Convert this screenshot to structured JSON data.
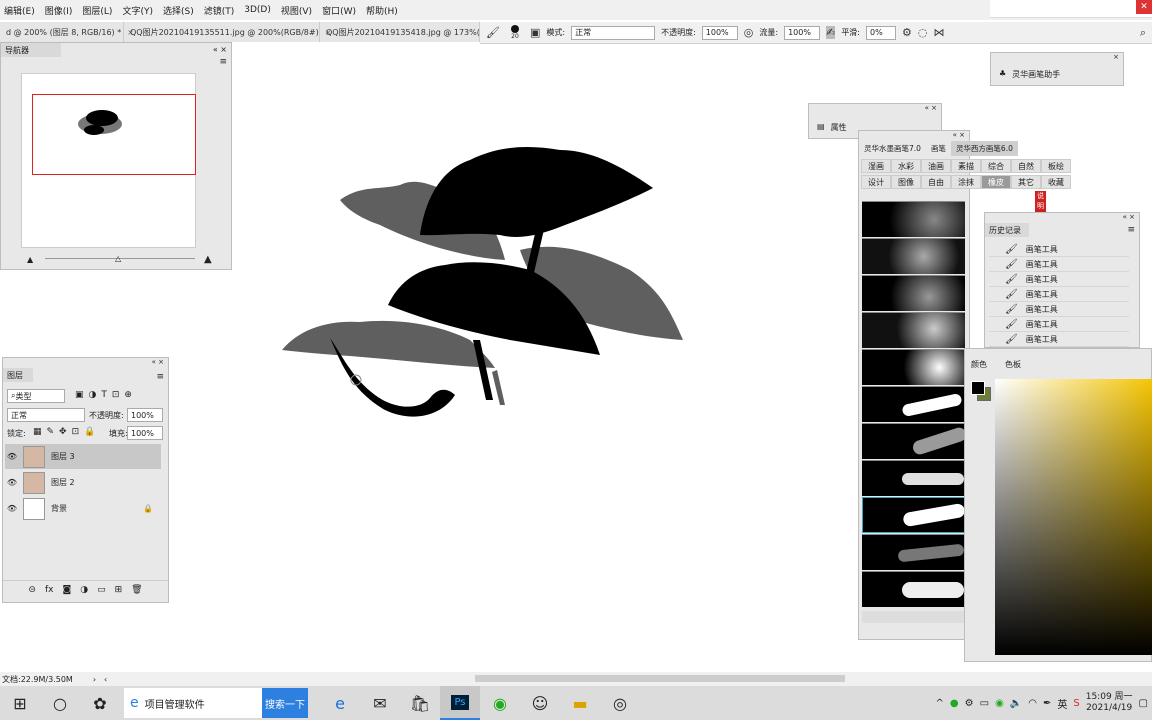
{
  "menu": [
    "编辑(E)",
    "图像(I)",
    "图层(L)",
    "文字(Y)",
    "选择(S)",
    "滤镜(T)",
    "3D(D)",
    "视图(V)",
    "窗口(W)",
    "帮助(H)"
  ],
  "doc_tabs": [
    {
      "label": "d @ 200% (图层 8, RGB/16) *",
      "close": "×"
    },
    {
      "label": "QQ图片20210419135511.jpg @ 200%(RGB/8#)",
      "close": "×"
    },
    {
      "label": "QQ图片20210419135418.jpg @ 173%(RG",
      "close": ""
    }
  ],
  "options": {
    "brush_size": "20",
    "mode_label": "模式:",
    "mode_value": "正常",
    "opacity_label": "不透明度:",
    "opacity_value": "100%",
    "flow_label": "流量:",
    "flow_value": "100%",
    "smooth_label": "平滑:",
    "smooth_value": "0%"
  },
  "navigator": {
    "tab": "导航器"
  },
  "layers_panel": {
    "tab": "图层",
    "filter": "类型",
    "blend": "正常",
    "opacity_label": "不透明度:",
    "opacity": "100%",
    "lock_label": "锁定:",
    "fill_label": "填充:",
    "fill": "100%",
    "layers": [
      {
        "name": "图层 3",
        "selected": true
      },
      {
        "name": "图层 2",
        "selected": false
      },
      {
        "name": "背景",
        "selected": false
      }
    ]
  },
  "brush_panel": {
    "tabs": [
      "灵华水墨画笔7.0",
      "画笔",
      "灵华西方画笔6.0"
    ],
    "grid": [
      "湿画",
      "水彩",
      "油画",
      "素描",
      "综合",
      "自然",
      "板绘",
      "设计",
      "图像",
      "自由",
      "涂抹",
      "橡皮",
      "其它",
      "收藏"
    ],
    "selected": "橡皮",
    "badge": "说明书"
  },
  "history_panel": {
    "tab": "历史记录",
    "items": [
      "画笔工具",
      "画笔工具",
      "画笔工具",
      "画笔工具",
      "画笔工具",
      "画笔工具",
      "画笔工具"
    ]
  },
  "color_panel": {
    "tabs": [
      "颜色",
      "色板"
    ]
  },
  "properties_panel": {
    "label": "属性"
  },
  "assistant_panel": {
    "label": "灵华画笔助手"
  },
  "status": {
    "doc_size": "文档:22.9M/3.50M"
  },
  "taskbar": {
    "search_placeholder": "项目管理软件",
    "search_button": "搜索一下",
    "ime": "英",
    "time": "15:09 周一",
    "date": "2021/4/19"
  },
  "colors": {
    "accent": "#2d7fe0",
    "fg": "#000000",
    "bg": "#6b7f3a",
    "nav_frame": "#dd2222"
  }
}
